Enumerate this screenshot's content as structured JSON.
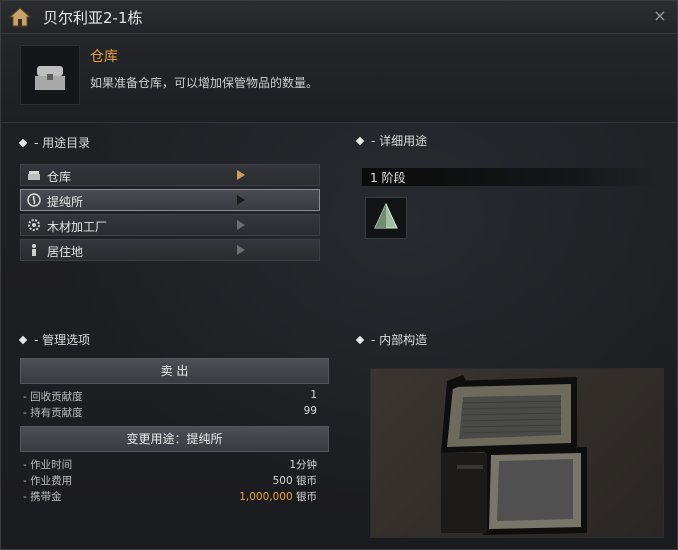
{
  "window": {
    "title": "贝尔利亚2-1栋",
    "close_glyph": "×"
  },
  "header": {
    "title": "仓库",
    "description": "如果准备仓库，可以增加保管物品的数量。"
  },
  "usage_section": {
    "label": "- 用途目录",
    "items": [
      {
        "label": "仓库",
        "icon": "chest-icon",
        "state": "current"
      },
      {
        "label": "提纯所",
        "icon": "refinery-icon",
        "state": "selected"
      },
      {
        "label": "木材加工厂",
        "icon": "gear-icon",
        "state": "normal"
      },
      {
        "label": "居住地",
        "icon": "person-icon",
        "state": "normal"
      }
    ]
  },
  "detail_section": {
    "label": "- 详细用途",
    "stage_label": "1 阶段",
    "stage_item_icon": "prism-icon"
  },
  "management_section": {
    "label": "- 管理选项",
    "sell_button": "卖 出",
    "contribution": [
      {
        "label": "- 回收贡献度",
        "value": "1"
      },
      {
        "label": "- 持有贡献度",
        "value": "99"
      }
    ],
    "change_button": "变更用途：提纯所",
    "work": [
      {
        "label": "- 作业时间",
        "value": "1分钟",
        "highlight": ""
      },
      {
        "label": "- 作业费用",
        "value": "500 银币",
        "highlight": ""
      },
      {
        "label": "- 携带金",
        "value": " 银币",
        "highlight": "1,000,000"
      }
    ]
  },
  "interior_section": {
    "label": "- 内部构造"
  },
  "colors": {
    "accent_orange": "#e79b3a",
    "gold": "#e7a340",
    "panel": "#1b1c1f"
  }
}
